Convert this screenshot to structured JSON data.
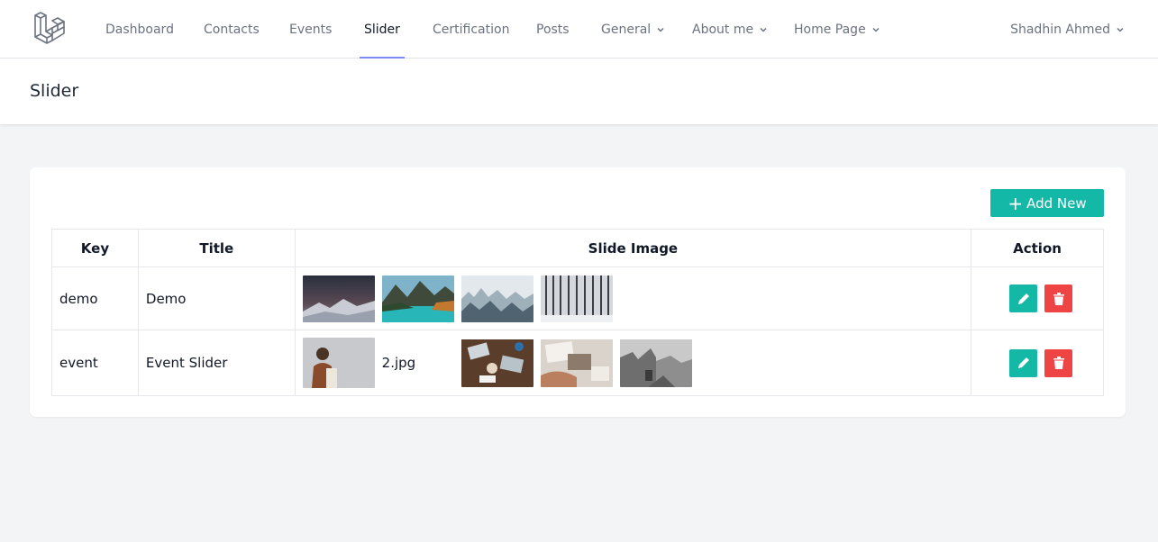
{
  "nav": {
    "items": [
      {
        "label": "Dashboard"
      },
      {
        "label": "Contacts"
      },
      {
        "label": "Events"
      },
      {
        "label": "Slider"
      },
      {
        "label": "Certification"
      },
      {
        "label": "Posts"
      },
      {
        "label": "General"
      },
      {
        "label": "About me"
      },
      {
        "label": "Home Page"
      }
    ],
    "active": "Slider",
    "user": "Shadhin Ahmed"
  },
  "page": {
    "title": "Slider"
  },
  "toolbar": {
    "add_label": "Add New"
  },
  "table": {
    "headers": [
      "Key",
      "Title",
      "Slide Image",
      "Action"
    ],
    "rows": [
      {
        "key": "demo",
        "title": "Demo",
        "images": [
          "night-mountain",
          "lake-mountains",
          "misty-forest",
          "snowy-forest"
        ]
      },
      {
        "key": "event",
        "title": "Event Slider",
        "images": [
          "woman-portrait",
          "2.jpg",
          "team-laptops",
          "desk-papers",
          "old-town"
        ]
      }
    ]
  },
  "colors": {
    "accent": "#14b8a6",
    "danger": "#ef4444",
    "active_underline": "#818cf8"
  }
}
